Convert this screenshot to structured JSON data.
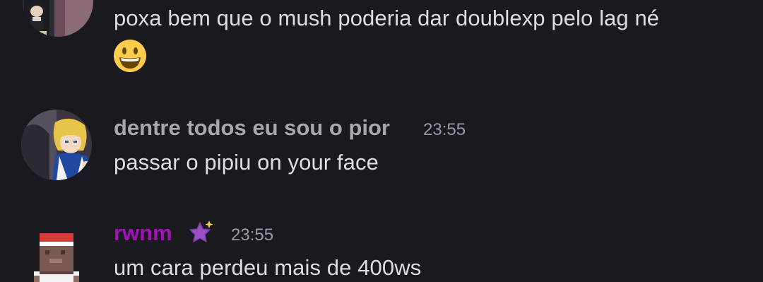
{
  "messages": [
    {
      "author": "",
      "time": "",
      "text": "poxa bem que o mush poderia dar doublexp pelo lag né",
      "emoji": "grinning-emoji"
    },
    {
      "author": "dentre todos eu sou o pior",
      "author_color": "#a6a8ae",
      "time": "23:55",
      "text": "passar o pipiu on your face"
    },
    {
      "author": "rwnm",
      "author_color": "#a111b8",
      "badge": "sparkle-star-badge",
      "time": "23:55",
      "text": "um cara perdeu mais de 400ws"
    }
  ],
  "colors": {
    "background": "#1a1a1e",
    "message_text": "#dbdee1",
    "timestamp": "#949ba4"
  }
}
